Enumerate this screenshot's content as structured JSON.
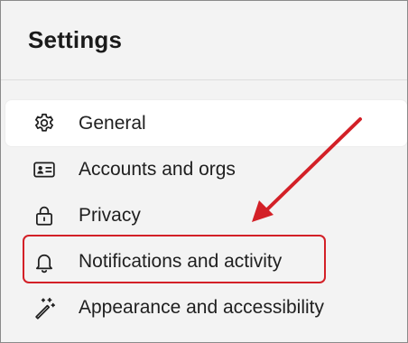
{
  "header": {
    "title": "Settings"
  },
  "nav": {
    "items": [
      {
        "label": "General",
        "icon": "gear-icon",
        "selected": true
      },
      {
        "label": "Accounts and orgs",
        "icon": "id-card-icon",
        "selected": false
      },
      {
        "label": "Privacy",
        "icon": "lock-icon",
        "selected": false
      },
      {
        "label": "Notifications and activity",
        "icon": "bell-icon",
        "selected": false
      },
      {
        "label": "Appearance and accessibility",
        "icon": "magic-wand-icon",
        "selected": false
      }
    ]
  },
  "annotation": {
    "highlighted_item": "Notifications and activity",
    "color": "#d32027"
  },
  "colors": {
    "background": "#f3f3f3",
    "selected_background": "#ffffff",
    "text": "#1f1f1f"
  }
}
